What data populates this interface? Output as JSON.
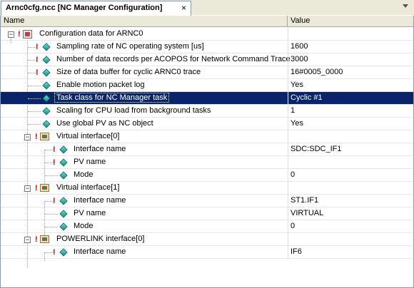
{
  "tab": {
    "title": "Arnc0cfg.ncc [NC Manager Configuration]",
    "close": "×"
  },
  "columns": {
    "name": "Name",
    "value": "Value"
  },
  "rows": [
    {
      "name": "Configuration data for ARNC0",
      "value": "",
      "icon": "root-icon"
    },
    {
      "name": "Sampling rate of NC operating system [us]",
      "value": "1600",
      "icon": "parameter-icon"
    },
    {
      "name": "Number of data records per ACOPOS for Network Command Trace",
      "value": "3000",
      "icon": "parameter-icon"
    },
    {
      "name": "Size of data buffer for cyclic ARNC0 trace",
      "value": "16#0005_0000",
      "icon": "parameter-icon"
    },
    {
      "name": "Enable motion packet log",
      "value": "Yes",
      "icon": "parameter-icon"
    },
    {
      "name": "Task class for NC Manager task",
      "value": "Cyclic #1",
      "icon": "parameter-icon"
    },
    {
      "name": "Scaling for CPU load from background tasks",
      "value": "1",
      "icon": "parameter-icon"
    },
    {
      "name": "Use global PV as NC object",
      "value": "Yes",
      "icon": "parameter-icon"
    },
    {
      "name": "Virtual interface[0]",
      "value": "",
      "icon": "group-icon"
    },
    {
      "name": "Interface name",
      "value": "SDC:SDC_IF1",
      "icon": "parameter-icon"
    },
    {
      "name": "PV name",
      "value": "",
      "icon": "parameter-icon"
    },
    {
      "name": "Mode",
      "value": "0",
      "icon": "parameter-icon"
    },
    {
      "name": "Virtual interface[1]",
      "value": "",
      "icon": "group-icon"
    },
    {
      "name": "Interface name",
      "value": "ST1.IF1",
      "icon": "parameter-icon"
    },
    {
      "name": "PV name",
      "value": "VIRTUAL",
      "icon": "parameter-icon"
    },
    {
      "name": "Mode",
      "value": "0",
      "icon": "parameter-icon"
    },
    {
      "name": "POWERLINK interface[0]",
      "value": "",
      "icon": "group-icon"
    },
    {
      "name": "Interface name",
      "value": "IF6",
      "icon": "parameter-icon"
    }
  ],
  "expander_symbol": "−",
  "warning_symbol": "!",
  "colors": {
    "selection": "#0a246a",
    "warning": "#d00000"
  }
}
